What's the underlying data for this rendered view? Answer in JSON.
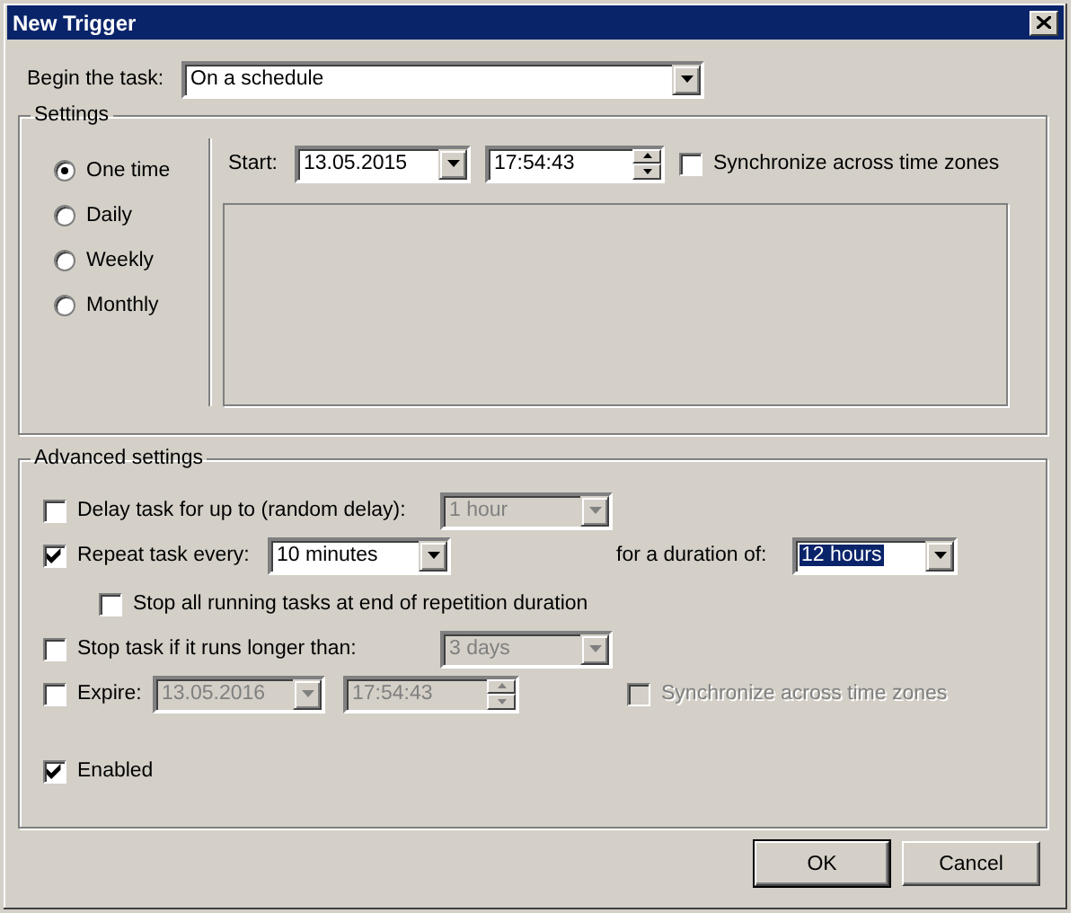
{
  "window": {
    "title": "New Trigger"
  },
  "begin_task": {
    "label": "Begin the task:",
    "value": "On a schedule"
  },
  "settings": {
    "title": "Settings",
    "schedules": [
      {
        "label": "One time",
        "selected": true
      },
      {
        "label": "Daily",
        "selected": false
      },
      {
        "label": "Weekly",
        "selected": false
      },
      {
        "label": "Monthly",
        "selected": false
      }
    ],
    "start": {
      "label": "Start:",
      "date": "13.05.2015",
      "time": "17:54:43"
    },
    "sync": {
      "label": "Synchronize across time zones",
      "checked": false
    }
  },
  "advanced": {
    "title": "Advanced settings",
    "delay": {
      "label": "Delay task for up to (random delay):",
      "checked": false,
      "value": "1 hour",
      "disabled": true
    },
    "repeat": {
      "label": "Repeat task every:",
      "checked": true,
      "value": "10 minutes",
      "duration_label": "for a duration of:",
      "duration": "12 hours",
      "duration_focused": true
    },
    "stop_all": {
      "label": "Stop all running tasks at end of repetition duration",
      "checked": false
    },
    "stop_longer": {
      "label": "Stop task if it runs longer than:",
      "checked": false,
      "value": "3 days",
      "disabled": true
    },
    "expire": {
      "label": "Expire:",
      "checked": false,
      "date": "13.05.2016",
      "time": "17:54:43",
      "disabled": true
    },
    "expire_sync": {
      "label": "Synchronize across time zones",
      "checked": false,
      "disabled": true
    },
    "enabled": {
      "label": "Enabled",
      "checked": true
    }
  },
  "buttons": [
    {
      "label": "OK",
      "default": true
    },
    {
      "label": "Cancel",
      "default": false
    }
  ]
}
